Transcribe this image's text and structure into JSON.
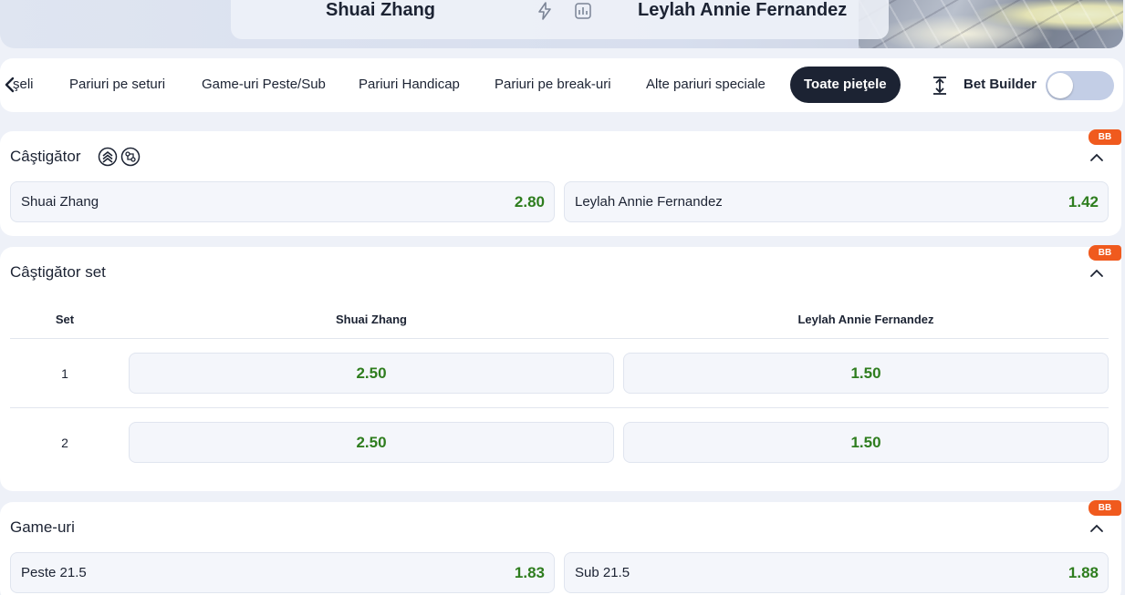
{
  "header": {
    "player1": "Shuai Zhang",
    "player2": "Leylah Annie Fernandez"
  },
  "tabs": {
    "back_label": "şeli",
    "items": [
      {
        "label": "Pariuri pe seturi"
      },
      {
        "label": "Game-uri Peste/Sub"
      },
      {
        "label": "Pariuri Handicap"
      },
      {
        "label": "Pariuri pe break-uri"
      },
      {
        "label": "Alte pariuri speciale"
      },
      {
        "label": "Toate pieţele",
        "active": true
      }
    ],
    "bet_builder_label": "Bet Builder",
    "bet_builder_enabled": false
  },
  "badge_label": "BB",
  "markets": {
    "winner": {
      "title": "Câştigător",
      "icons": [
        "live-stream-icon",
        "stats-ring-icon"
      ],
      "selections": [
        {
          "name": "Shuai Zhang",
          "odds": "2.80"
        },
        {
          "name": "Leylah Annie Fernandez",
          "odds": "1.42"
        }
      ]
    },
    "set_winner": {
      "title": "Câştigător set",
      "headers": {
        "set": "Set",
        "p1": "Shuai Zhang",
        "p2": "Leylah Annie Fernandez"
      },
      "rows": [
        {
          "set": "1",
          "p1": "2.50",
          "p2": "1.50"
        },
        {
          "set": "2",
          "p1": "2.50",
          "p2": "1.50"
        }
      ]
    },
    "games": {
      "title": "Game-uri",
      "selections": [
        {
          "name": "Peste 21.5",
          "odds": "1.83"
        },
        {
          "name": "Sub 21.5",
          "odds": "1.88"
        }
      ]
    }
  },
  "colors": {
    "odds": "#2e7d1e",
    "accent_dark": "#1c2333",
    "badge": "#f05a1e",
    "toggle_off": "#c3cee6"
  }
}
